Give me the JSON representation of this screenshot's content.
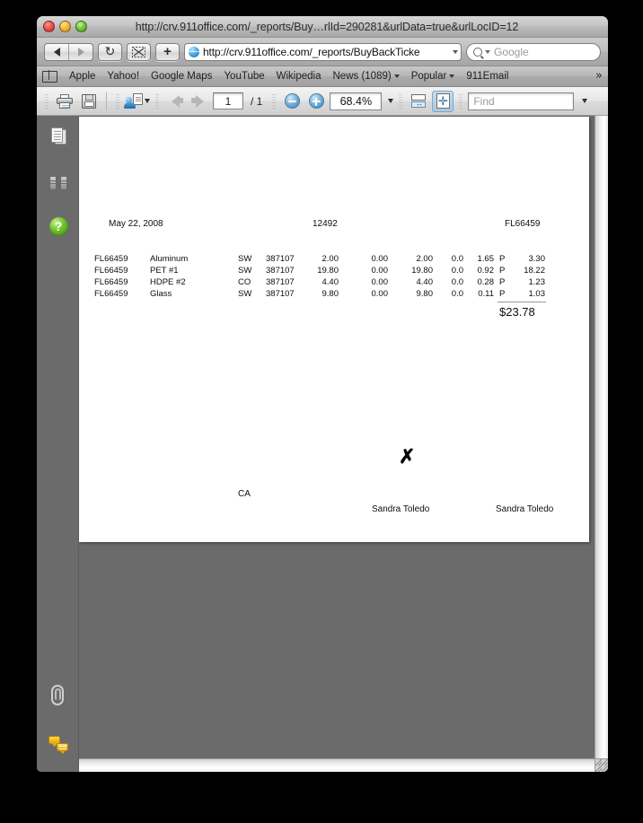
{
  "window": {
    "title": "http://crv.911office.com/_reports/Buy…rlId=290281&urlData=true&urlLocID=12",
    "traffic_lights": [
      "close",
      "minimize",
      "zoom"
    ]
  },
  "navbar": {
    "back_icon": "back-arrow-icon",
    "forward_icon": "forward-arrow-icon",
    "reload_glyph": "↻",
    "snippet_icon": "snippet-icon",
    "add_glyph": "+",
    "url_value": "http://crv.911office.com/_reports/BuyBackTicke",
    "search_placeholder": "Google"
  },
  "bookmarks": {
    "book_icon": "book-icon",
    "items": [
      {
        "label": "Apple",
        "menu": false
      },
      {
        "label": "Yahoo!",
        "menu": false
      },
      {
        "label": "Google Maps",
        "menu": false
      },
      {
        "label": "YouTube",
        "menu": false
      },
      {
        "label": "Wikipedia",
        "menu": false
      },
      {
        "label": "News (1089)",
        "menu": true
      },
      {
        "label": "Popular",
        "menu": true
      },
      {
        "label": "911Email",
        "menu": false
      }
    ],
    "overflow_glyph": "»"
  },
  "pdf_toolbar": {
    "print_icon": "printer-icon",
    "save_icon": "floppy-disk-icon",
    "sign_icon": "sign-document-icon",
    "prev_page_icon": "previous-page-arrow-icon",
    "next_page_icon": "next-page-arrow-icon",
    "page_number": "1",
    "page_count": "/ 1",
    "zoom_out_icon": "zoom-out-icon",
    "zoom_in_icon": "zoom-in-icon",
    "zoom_level": "68.4%",
    "fit_width_icon": "fit-width-icon",
    "fit_page_icon": "fit-page-icon",
    "find_placeholder": "Find"
  },
  "sidebar": {
    "items": [
      {
        "name": "pages-panel",
        "icon": "pages-icon"
      },
      {
        "name": "search-panel",
        "icon": "binoculars-icon"
      },
      {
        "name": "help-panel",
        "icon": "help-icon",
        "glyph": "?"
      },
      {
        "name": "attachments-panel",
        "icon": "paperclip-icon"
      },
      {
        "name": "comments-panel",
        "icon": "comment-bubbles-icon"
      }
    ]
  },
  "document": {
    "date": "May 22, 2008",
    "ticket_number": "12492",
    "location_code_header": "FL66459",
    "rows": [
      {
        "loc": "FL66459",
        "material": "Aluminum",
        "type": "SW",
        "cert": "387107",
        "gross": "2.00",
        "tare": "0.00",
        "net": "2.00",
        "pct": "0.0",
        "rate": "1.65",
        "flag": "P",
        "amount": "3.30"
      },
      {
        "loc": "FL66459",
        "material": "PET #1",
        "type": "SW",
        "cert": "387107",
        "gross": "19.80",
        "tare": "0.00",
        "net": "19.80",
        "pct": "0.0",
        "rate": "0.92",
        "flag": "P",
        "amount": "18.22"
      },
      {
        "loc": "FL66459",
        "material": "HDPE #2",
        "type": "CO",
        "cert": "387107",
        "gross": "4.40",
        "tare": "0.00",
        "net": "4.40",
        "pct": "0.0",
        "rate": "0.28",
        "flag": "P",
        "amount": "1.23"
      },
      {
        "loc": "FL66459",
        "material": "Glass",
        "type": "SW",
        "cert": "387107",
        "gross": "9.80",
        "tare": "0.00",
        "net": "9.80",
        "pct": "0.0",
        "rate": "0.11",
        "flag": "P",
        "amount": "1.03"
      }
    ],
    "total": "$23.78",
    "state": "CA",
    "signature_mark": "✗",
    "signature_left": "Sandra Toledo",
    "signature_right": "Sandra Toledo"
  }
}
